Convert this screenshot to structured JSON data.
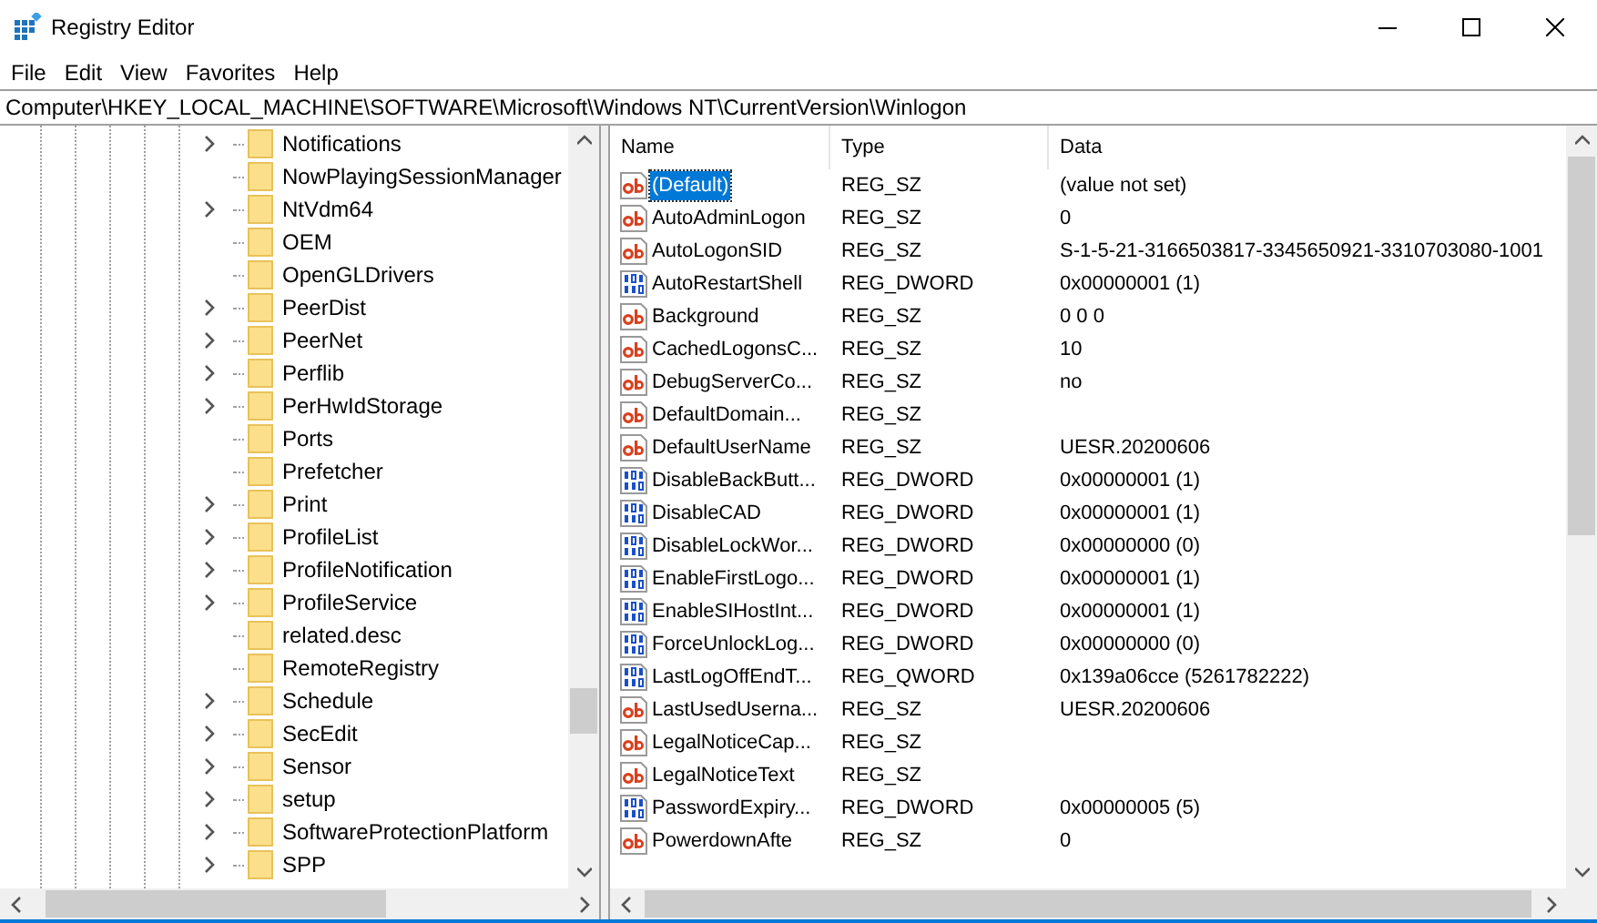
{
  "window": {
    "title": "Registry Editor"
  },
  "menu": [
    "File",
    "Edit",
    "View",
    "Favorites",
    "Help"
  ],
  "address": "Computer\\HKEY_LOCAL_MACHINE\\SOFTWARE\\Microsoft\\Windows NT\\CurrentVersion\\Winlogon",
  "tree": [
    {
      "label": "Notifications",
      "expandable": true
    },
    {
      "label": "NowPlayingSessionManager",
      "expandable": false
    },
    {
      "label": "NtVdm64",
      "expandable": true
    },
    {
      "label": "OEM",
      "expandable": false
    },
    {
      "label": "OpenGLDrivers",
      "expandable": false
    },
    {
      "label": "PeerDist",
      "expandable": true
    },
    {
      "label": "PeerNet",
      "expandable": true
    },
    {
      "label": "Perflib",
      "expandable": true
    },
    {
      "label": "PerHwIdStorage",
      "expandable": true
    },
    {
      "label": "Ports",
      "expandable": false
    },
    {
      "label": "Prefetcher",
      "expandable": false
    },
    {
      "label": "Print",
      "expandable": true
    },
    {
      "label": "ProfileList",
      "expandable": true
    },
    {
      "label": "ProfileNotification",
      "expandable": true
    },
    {
      "label": "ProfileService",
      "expandable": true
    },
    {
      "label": "related.desc",
      "expandable": false
    },
    {
      "label": "RemoteRegistry",
      "expandable": false
    },
    {
      "label": "Schedule",
      "expandable": true
    },
    {
      "label": "SecEdit",
      "expandable": true
    },
    {
      "label": "Sensor",
      "expandable": true
    },
    {
      "label": "setup",
      "expandable": true
    },
    {
      "label": "SoftwareProtectionPlatform",
      "expandable": true
    },
    {
      "label": "SPP",
      "expandable": true
    }
  ],
  "table": {
    "columns": [
      "Name",
      "Type",
      "Data"
    ],
    "rows": [
      {
        "kind": "string",
        "selected": true,
        "name": "(Default)",
        "type": "REG_SZ",
        "data": "(value not set)"
      },
      {
        "kind": "string",
        "selected": false,
        "name": "AutoAdminLogon",
        "type": "REG_SZ",
        "data": "0"
      },
      {
        "kind": "string",
        "selected": false,
        "name": "AutoLogonSID",
        "type": "REG_SZ",
        "data": "S-1-5-21-3166503817-3345650921-3310703080-1001"
      },
      {
        "kind": "binary",
        "selected": false,
        "name": "AutoRestartShell",
        "type": "REG_DWORD",
        "data": "0x00000001 (1)"
      },
      {
        "kind": "string",
        "selected": false,
        "name": "Background",
        "type": "REG_SZ",
        "data": "0 0 0"
      },
      {
        "kind": "string",
        "selected": false,
        "name": "CachedLogonsC...",
        "type": "REG_SZ",
        "data": "10"
      },
      {
        "kind": "string",
        "selected": false,
        "name": "DebugServerCo...",
        "type": "REG_SZ",
        "data": "no"
      },
      {
        "kind": "string",
        "selected": false,
        "name": "DefaultDomain...",
        "type": "REG_SZ",
        "data": ""
      },
      {
        "kind": "string",
        "selected": false,
        "name": "DefaultUserName",
        "type": "REG_SZ",
        "data": "UESR.20200606"
      },
      {
        "kind": "binary",
        "selected": false,
        "name": "DisableBackButt...",
        "type": "REG_DWORD",
        "data": "0x00000001 (1)"
      },
      {
        "kind": "binary",
        "selected": false,
        "name": "DisableCAD",
        "type": "REG_DWORD",
        "data": "0x00000001 (1)"
      },
      {
        "kind": "binary",
        "selected": false,
        "name": "DisableLockWor...",
        "type": "REG_DWORD",
        "data": "0x00000000 (0)"
      },
      {
        "kind": "binary",
        "selected": false,
        "name": "EnableFirstLogo...",
        "type": "REG_DWORD",
        "data": "0x00000001 (1)"
      },
      {
        "kind": "binary",
        "selected": false,
        "name": "EnableSIHostInt...",
        "type": "REG_DWORD",
        "data": "0x00000001 (1)"
      },
      {
        "kind": "binary",
        "selected": false,
        "name": "ForceUnlockLog...",
        "type": "REG_DWORD",
        "data": "0x00000000 (0)"
      },
      {
        "kind": "binary",
        "selected": false,
        "name": "LastLogOffEndT...",
        "type": "REG_QWORD",
        "data": "0x139a06cce (5261782222)"
      },
      {
        "kind": "string",
        "selected": false,
        "name": "LastUsedUserna...",
        "type": "REG_SZ",
        "data": "UESR.20200606"
      },
      {
        "kind": "string",
        "selected": false,
        "name": "LegalNoticeCap...",
        "type": "REG_SZ",
        "data": ""
      },
      {
        "kind": "string",
        "selected": false,
        "name": "LegalNoticeText",
        "type": "REG_SZ",
        "data": ""
      },
      {
        "kind": "binary",
        "selected": false,
        "name": "PasswordExpiry...",
        "type": "REG_DWORD",
        "data": "0x00000005 (5)"
      },
      {
        "kind": "string",
        "selected": false,
        "name": "PowerdownAfte",
        "type": "REG_SZ",
        "data": "0"
      }
    ]
  }
}
